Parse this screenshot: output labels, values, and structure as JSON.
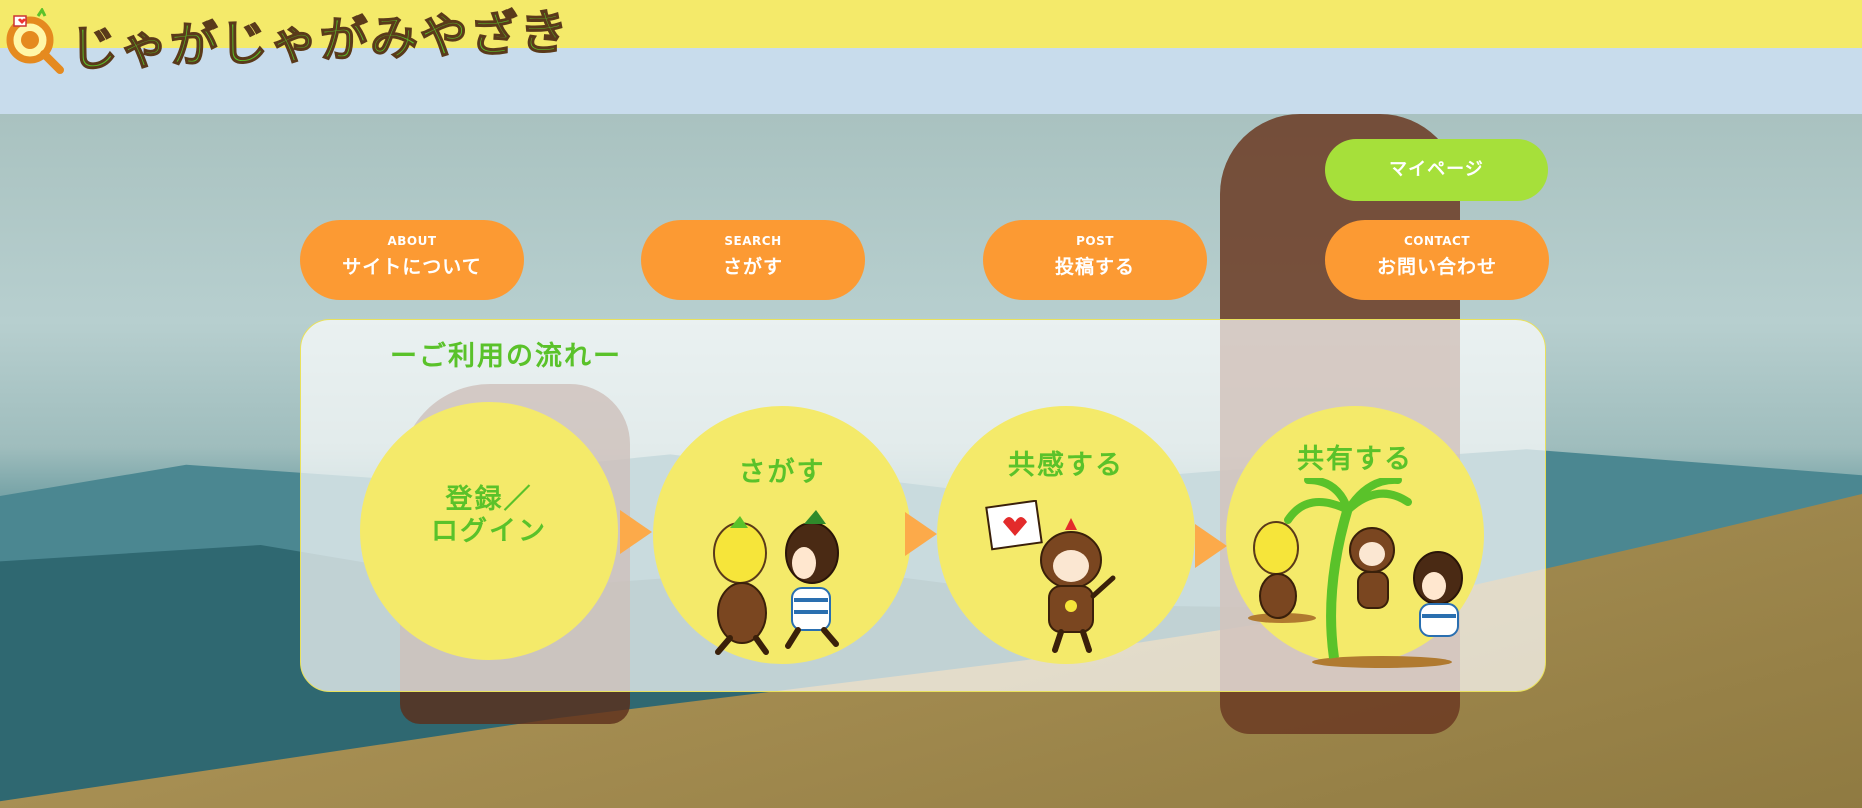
{
  "header": {
    "logo_text": "じゃがじゃがみやざき"
  },
  "nav": {
    "mypage": "マイページ",
    "items": [
      {
        "en": "ABOUT",
        "ja": "サイトについて"
      },
      {
        "en": "SEARCH",
        "ja": "さがす"
      },
      {
        "en": "POST",
        "ja": "投稿する"
      },
      {
        "en": "CONTACT",
        "ja": "お問い合わせ"
      }
    ]
  },
  "flow": {
    "title": "ーご利用の流れー",
    "steps": [
      {
        "line1": "登録／",
        "line2": "ログイン"
      },
      {
        "label": "さがす"
      },
      {
        "label": "共感する"
      },
      {
        "label": "共有する"
      }
    ]
  },
  "colors": {
    "top_bar": "#f4ea6a",
    "nav_orange": "#fc9a33",
    "mypage_green": "#a6e03a",
    "accent_green": "#5ac22a",
    "circle_yellow": "#f4ea6a"
  }
}
